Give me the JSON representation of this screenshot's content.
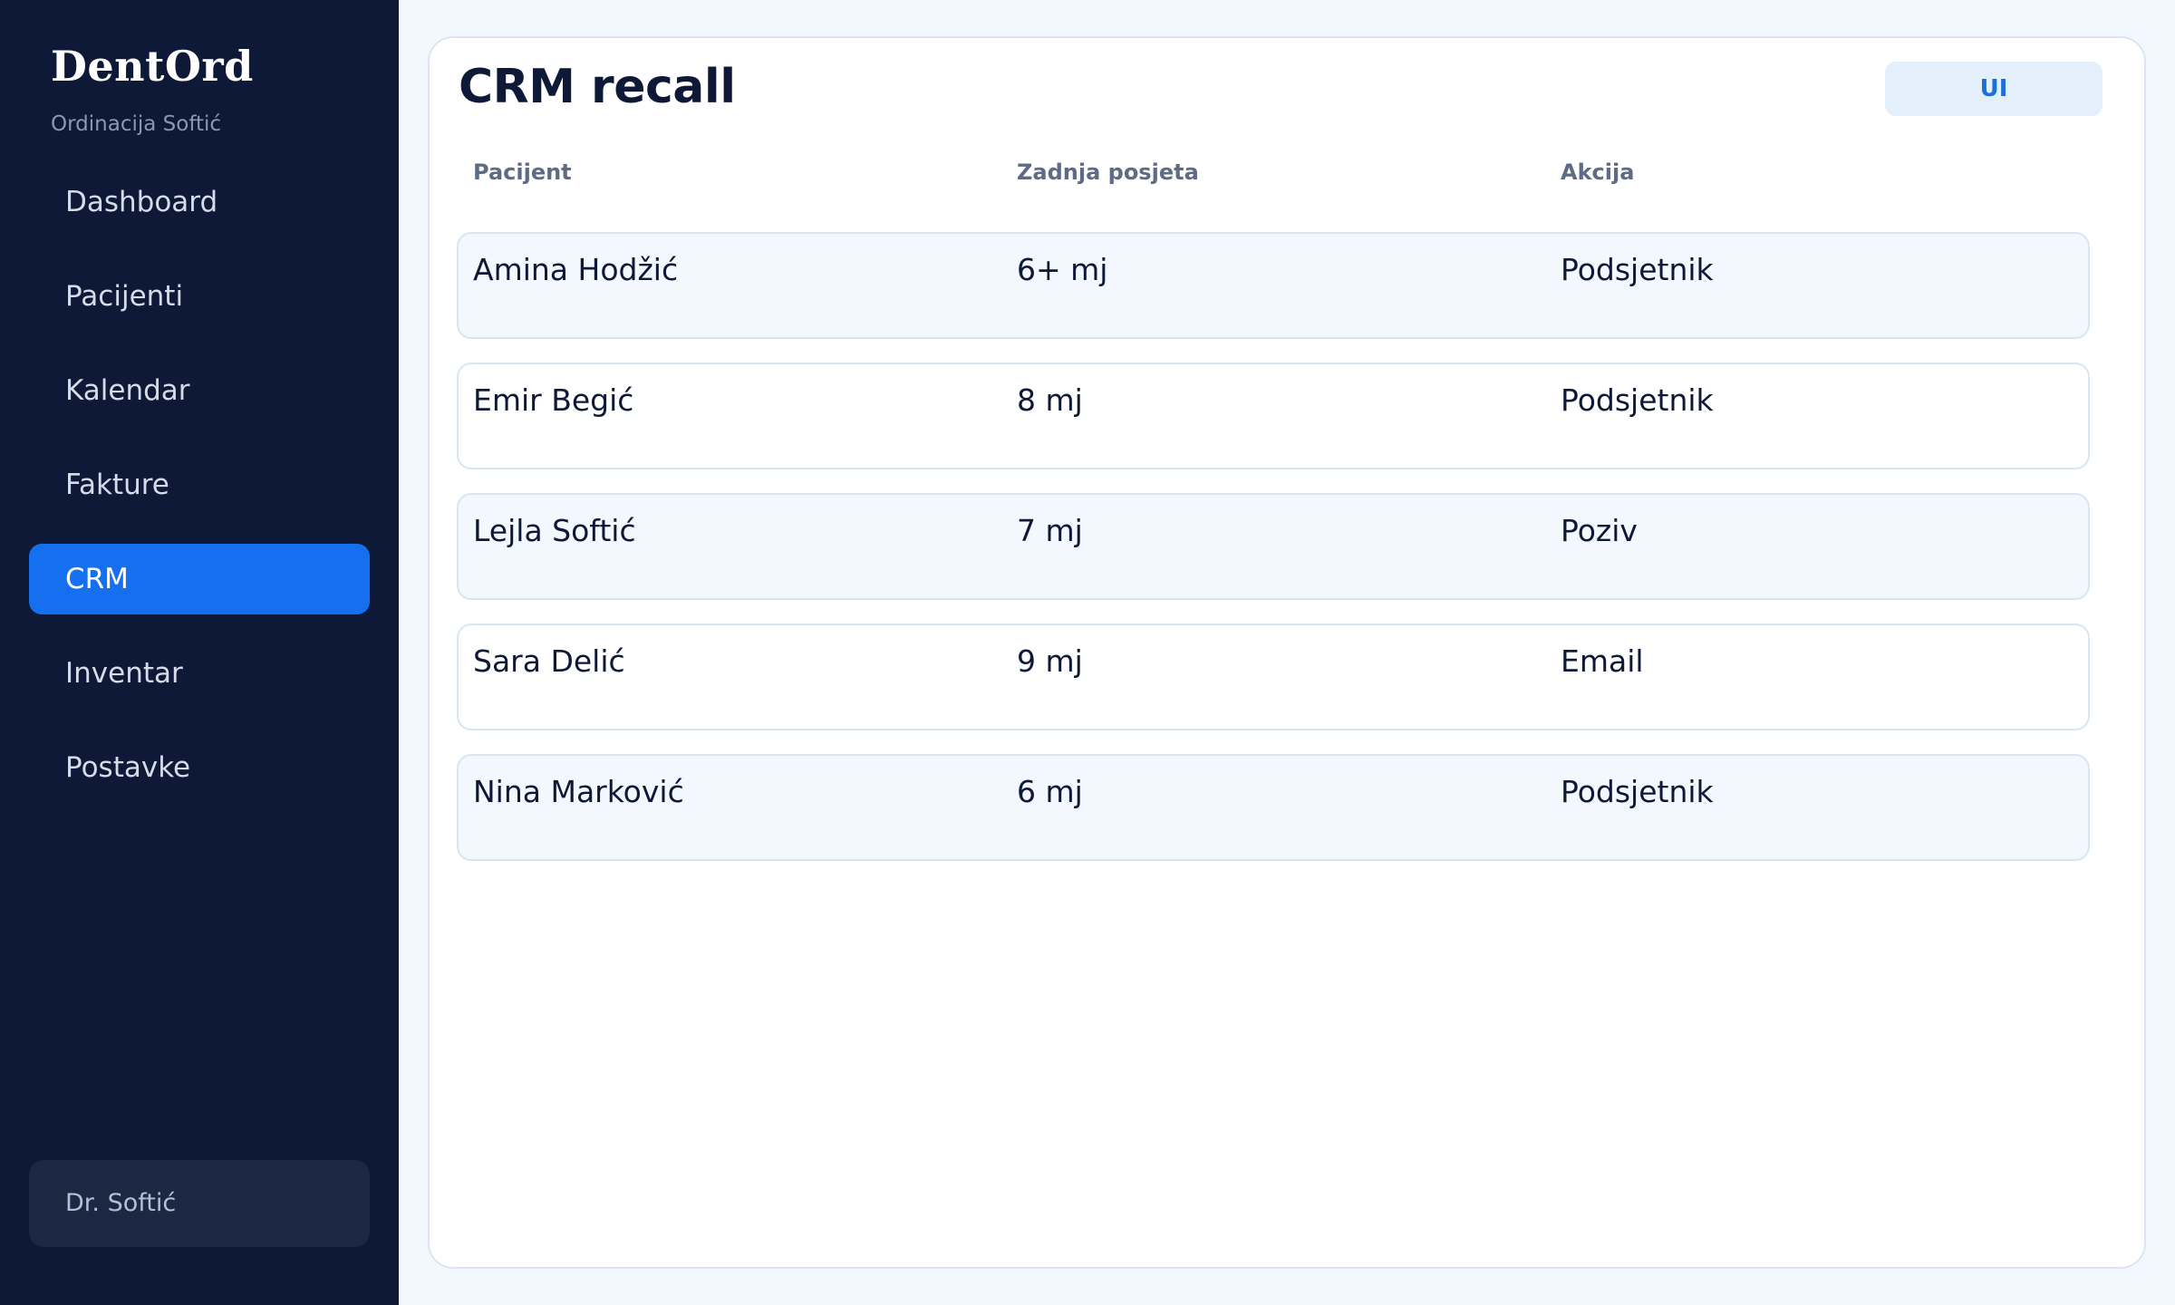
{
  "brand": {
    "title": "DentOrd",
    "subtitle": "Ordinacija Softić"
  },
  "nav": {
    "items": [
      {
        "label": "Dashboard",
        "active": false
      },
      {
        "label": "Pacijenti",
        "active": false
      },
      {
        "label": "Kalendar",
        "active": false
      },
      {
        "label": "Fakture",
        "active": false
      },
      {
        "label": "CRM",
        "active": true
      },
      {
        "label": "Inventar",
        "active": false
      },
      {
        "label": "Postavke",
        "active": false
      }
    ]
  },
  "user": {
    "name": "Dr. Softić"
  },
  "main": {
    "title": "CRM recall",
    "mode_button": "UI",
    "columns": [
      "Pacijent",
      "Zadnja posjeta",
      "Akcija"
    ],
    "rows": [
      {
        "patient": "Amina Hodžić",
        "last_visit": "6+ mj",
        "action": "Podsjetnik"
      },
      {
        "patient": "Emir Begić",
        "last_visit": "8 mj",
        "action": "Podsjetnik"
      },
      {
        "patient": "Lejla Softić",
        "last_visit": "7 mj",
        "action": "Poziv"
      },
      {
        "patient": "Sara Delić",
        "last_visit": "9 mj",
        "action": "Email"
      },
      {
        "patient": "Nina Marković",
        "last_visit": "6 mj",
        "action": "Podsjetnik"
      }
    ]
  },
  "colors": {
    "sidebar_bg": "#0e1837",
    "accent": "#1570ef",
    "page_bg": "#f2f7fd",
    "row_alt_bg": "#f3f8fe",
    "button_bg": "#e3effb",
    "button_text": "#1a6fdd"
  }
}
